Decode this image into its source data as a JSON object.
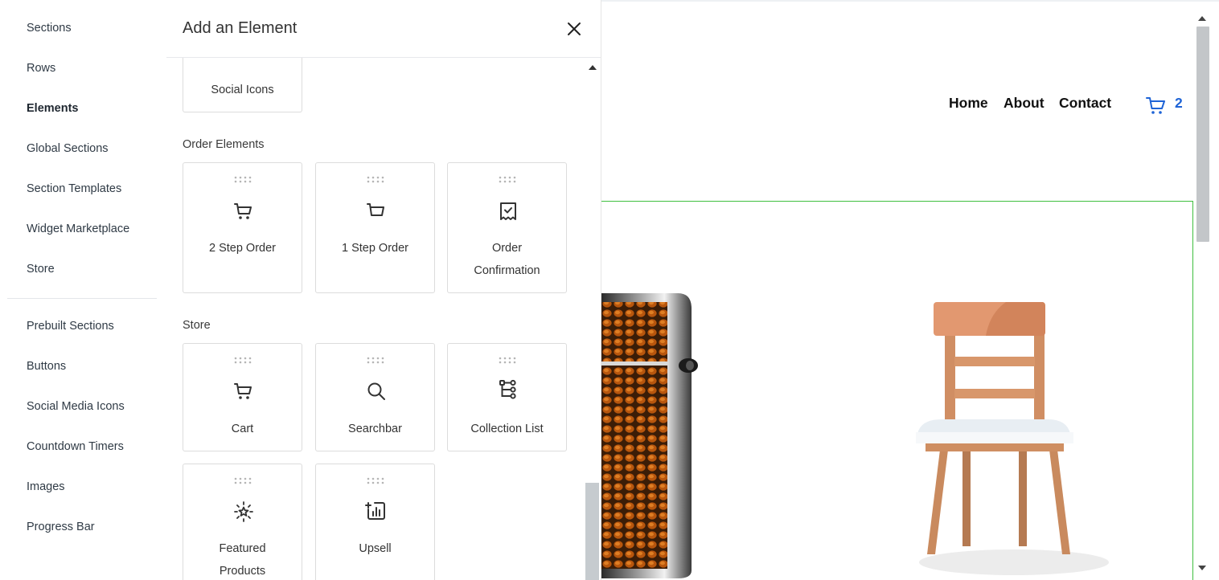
{
  "left_nav": {
    "items": [
      {
        "label": "Sections"
      },
      {
        "label": "Rows"
      },
      {
        "label": "Elements"
      },
      {
        "label": "Global Sections"
      },
      {
        "label": "Section Templates"
      },
      {
        "label": "Widget Marketplace"
      },
      {
        "label": "Store"
      }
    ],
    "items2": [
      {
        "label": "Prebuilt Sections"
      },
      {
        "label": "Buttons"
      },
      {
        "label": "Social Media Icons"
      },
      {
        "label": "Countdown Timers"
      },
      {
        "label": "Images"
      },
      {
        "label": "Progress Bar"
      }
    ],
    "active": "Elements"
  },
  "panel": {
    "title": "Add an Element",
    "top_card": {
      "label": "Social Icons"
    },
    "order_section": {
      "label": "Order Elements",
      "cards": [
        {
          "label": "2 Step Order",
          "icon": "cart-icon"
        },
        {
          "label": "1 Step Order",
          "icon": "cart-icon"
        },
        {
          "label_line1": "Order",
          "label_line2": "Confirmation",
          "icon": "receipt-check-icon"
        }
      ]
    },
    "store_section": {
      "label": "Store",
      "cards": [
        {
          "label": "Cart",
          "icon": "cart-icon"
        },
        {
          "label": "Searchbar",
          "icon": "search-icon"
        },
        {
          "label": "Collection List",
          "icon": "hierarchy-icon"
        },
        {
          "label_line1": "Featured",
          "label_line2": "Products",
          "icon": "sparkle-star-icon"
        },
        {
          "label": "Upsell",
          "icon": "chart-plus-icon"
        }
      ]
    }
  },
  "preview": {
    "menu": [
      {
        "label": "Home"
      },
      {
        "label": "About"
      },
      {
        "label": "Contact"
      }
    ],
    "cart_count": "2",
    "accent_color": "#1e63d6",
    "outline_color": "#3fbf3f"
  }
}
